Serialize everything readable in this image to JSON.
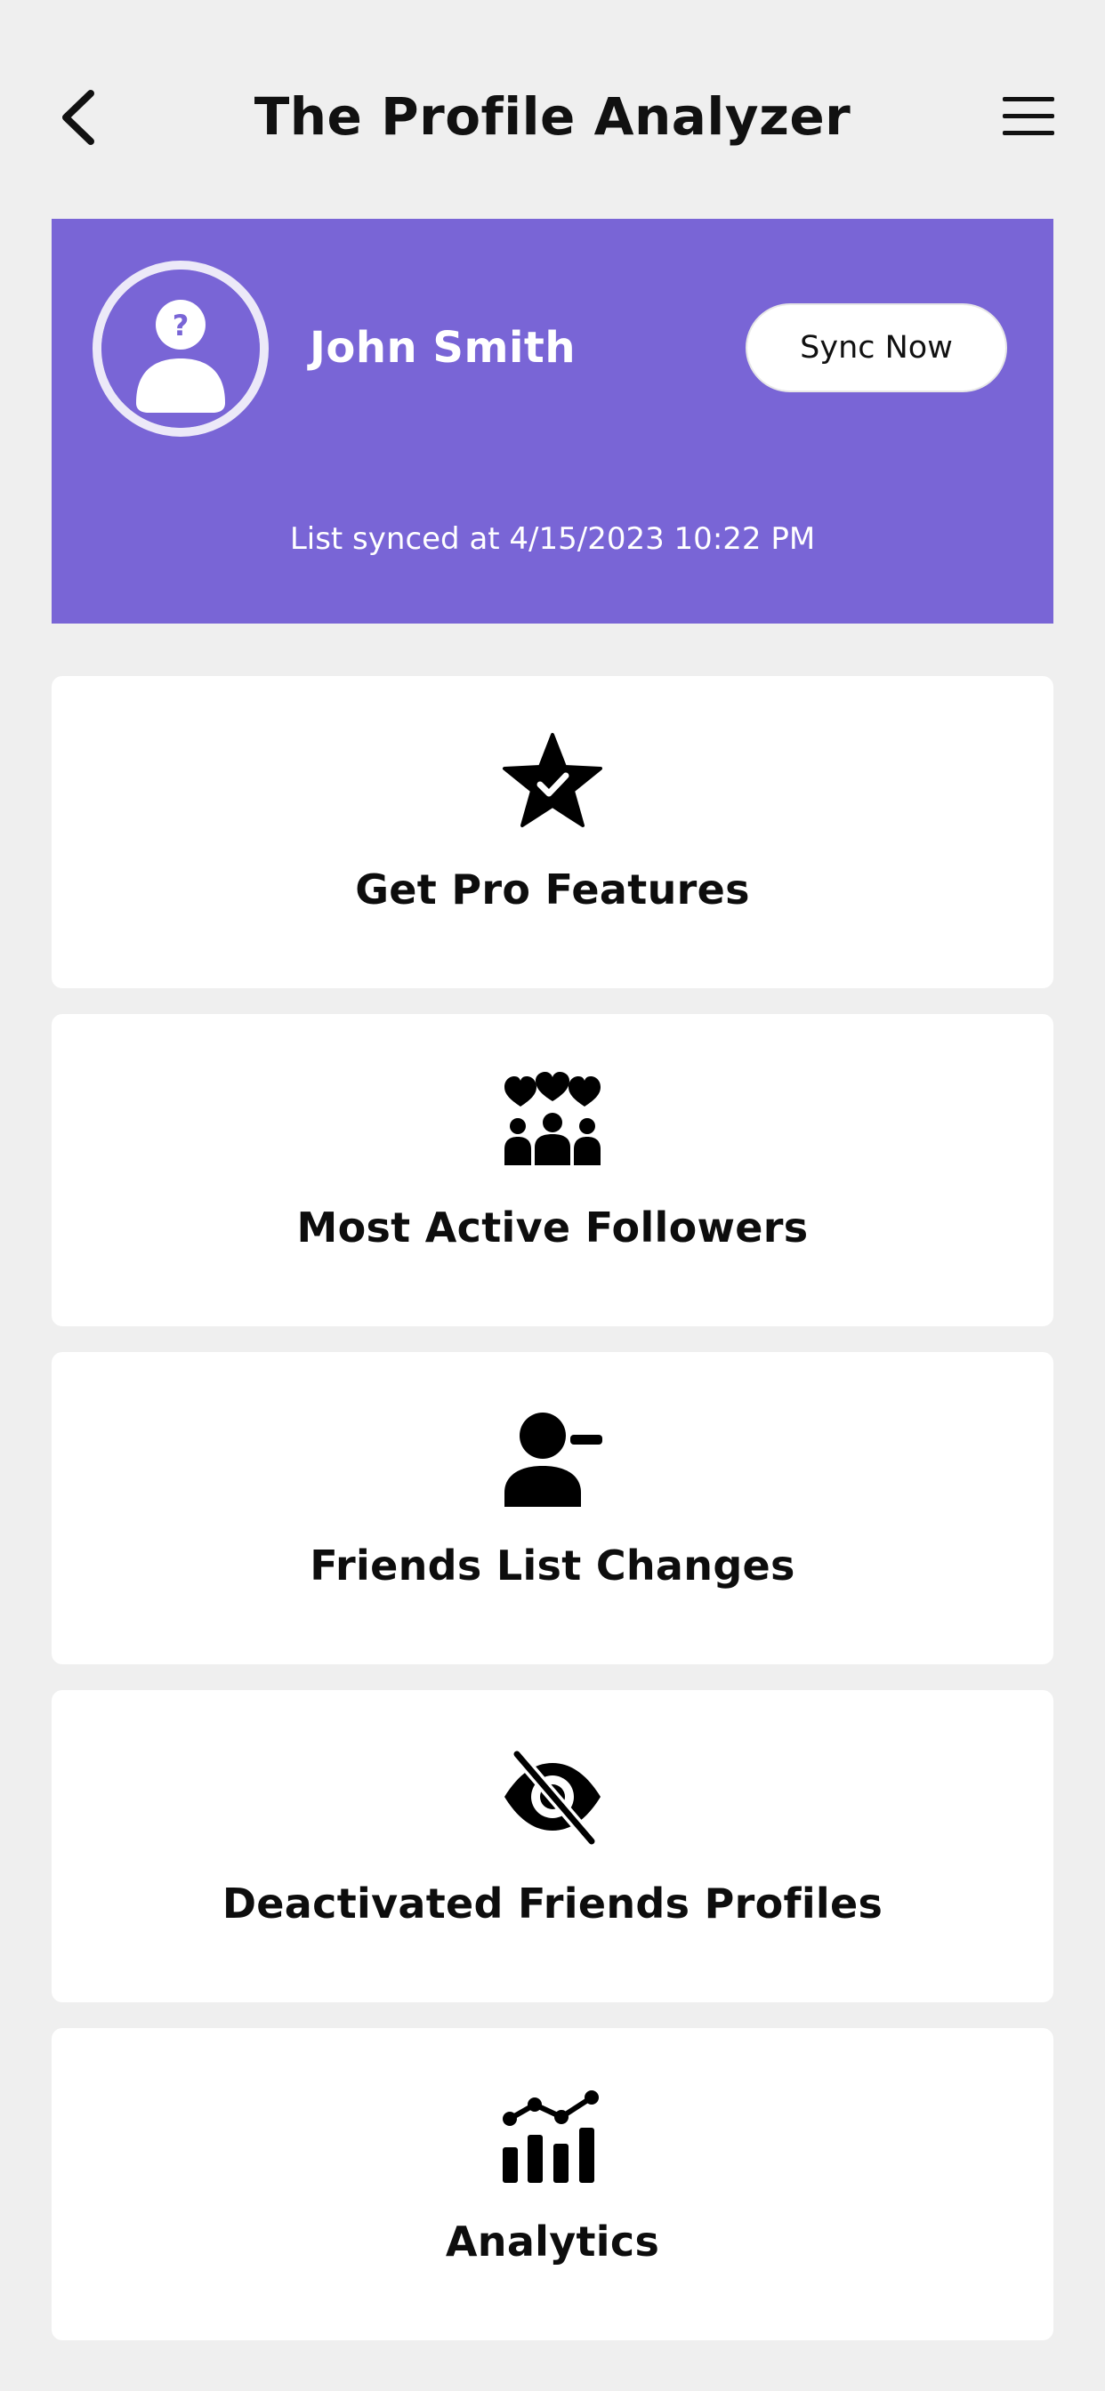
{
  "header": {
    "title": "The Profile Analyzer",
    "back_icon": "chevron-left-icon",
    "menu_icon": "hamburger-menu-icon"
  },
  "profile": {
    "name": "John Smith",
    "sync_button_label": "Sync Now",
    "sync_status": "List synced at 4/15/2023 10:22 PM",
    "avatar_icon": "unknown-user-icon",
    "card_color": "#7965d6"
  },
  "menu": {
    "items": [
      {
        "label": "Get Pro Features",
        "icon": "star-check-icon"
      },
      {
        "label": "Most Active Followers",
        "icon": "followers-hearts-icon"
      },
      {
        "label": "Friends List Changes",
        "icon": "user-minus-icon"
      },
      {
        "label": "Deactivated Friends Profiles",
        "icon": "eye-slash-icon"
      },
      {
        "label": "Analytics",
        "icon": "analytics-chart-icon"
      }
    ]
  }
}
